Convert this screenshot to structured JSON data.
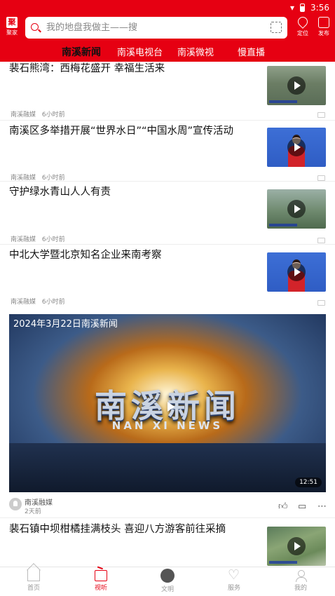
{
  "status": {
    "time": "3:56"
  },
  "header": {
    "logo_label": "聚家",
    "search_placeholder": "我的地盘我做主——搜",
    "location_label": "定位",
    "publish_label": "发布"
  },
  "tabs": [
    "南溪新闻",
    "南溪电视台",
    "南溪微视",
    "慢直播"
  ],
  "active_tab": 0,
  "news": [
    {
      "title": "裴石熊湾：西梅花盛开 幸福生活来",
      "source": "南溪融媒",
      "time": "6小时前"
    },
    {
      "title": "南溪区多举措开展“世界水日”“中国水周”宣传活动",
      "source": "南溪融媒",
      "time": "6小时前"
    },
    {
      "title": "守护绿水青山人人有责",
      "source": "南溪融媒",
      "time": "6小时前"
    },
    {
      "title": "中北大学暨北京知名企业来南考察",
      "source": "南溪融媒",
      "time": "6小时前"
    }
  ],
  "video": {
    "title": "2024年3月22日南溪新闻",
    "logo_cn": "南溪新闻",
    "logo_en": "NAN XI NEWS",
    "duration": "12:51",
    "source": "南溪融媒",
    "time": "2天前"
  },
  "last_news": {
    "title": "裴石镇中坝柑橘挂满枝头 喜迎八方游客前往采摘"
  },
  "bottom_nav": [
    {
      "label": "首页",
      "icon": "home-icon"
    },
    {
      "label": "视听",
      "icon": "tv-icon"
    },
    {
      "label": "文明",
      "icon": "wenming-icon"
    },
    {
      "label": "服务",
      "icon": "heart-icon"
    },
    {
      "label": "我的",
      "icon": "user-icon"
    }
  ],
  "colors": {
    "brand": "#e60012"
  }
}
